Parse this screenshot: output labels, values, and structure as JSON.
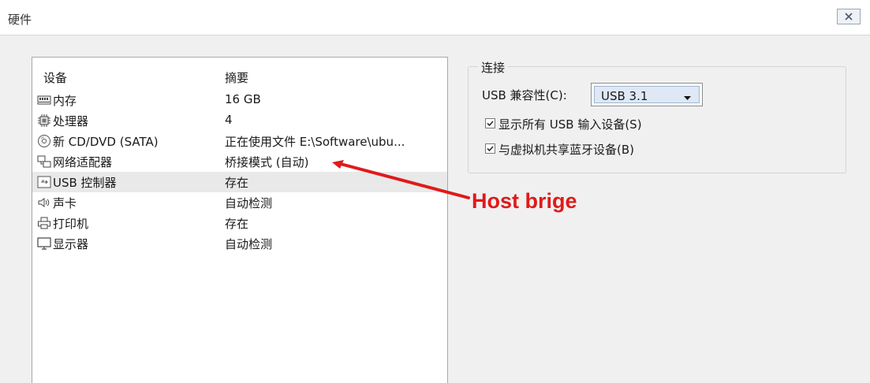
{
  "window": {
    "title": "硬件",
    "close_icon": "close-icon"
  },
  "device_list": {
    "columns": {
      "device": "设备",
      "summary": "摘要"
    },
    "items": [
      {
        "name": "内存",
        "summary": "16 GB",
        "icon": "memory-icon"
      },
      {
        "name": "处理器",
        "summary": "4",
        "icon": "processor-icon"
      },
      {
        "name": "新 CD/DVD (SATA)",
        "summary": "正在使用文件 E:\\Software\\ubu...",
        "icon": "cd-dvd-icon"
      },
      {
        "name": "网络适配器",
        "summary": "桥接模式 (自动)",
        "icon": "network-adapter-icon"
      },
      {
        "name": "USB 控制器",
        "summary": "存在",
        "icon": "usb-controller-icon",
        "selected": true
      },
      {
        "name": "声卡",
        "summary": "自动检测",
        "icon": "speaker-icon"
      },
      {
        "name": "打印机",
        "summary": "存在",
        "icon": "printer-icon"
      },
      {
        "name": "显示器",
        "summary": "自动检测",
        "icon": "monitor-icon"
      }
    ]
  },
  "connection": {
    "legend": "连接",
    "usb_compat_label": "USB 兼容性(C):",
    "usb_compat_value": "USB 3.1",
    "show_all_usb": {
      "label": "显示所有 USB 输入设备(S)",
      "checked": true
    },
    "share_bluetooth": {
      "label": "与虚拟机共享蓝牙设备(B)",
      "checked": true
    }
  },
  "annotation": {
    "text": "Host brige",
    "color": "#e01a1a"
  }
}
